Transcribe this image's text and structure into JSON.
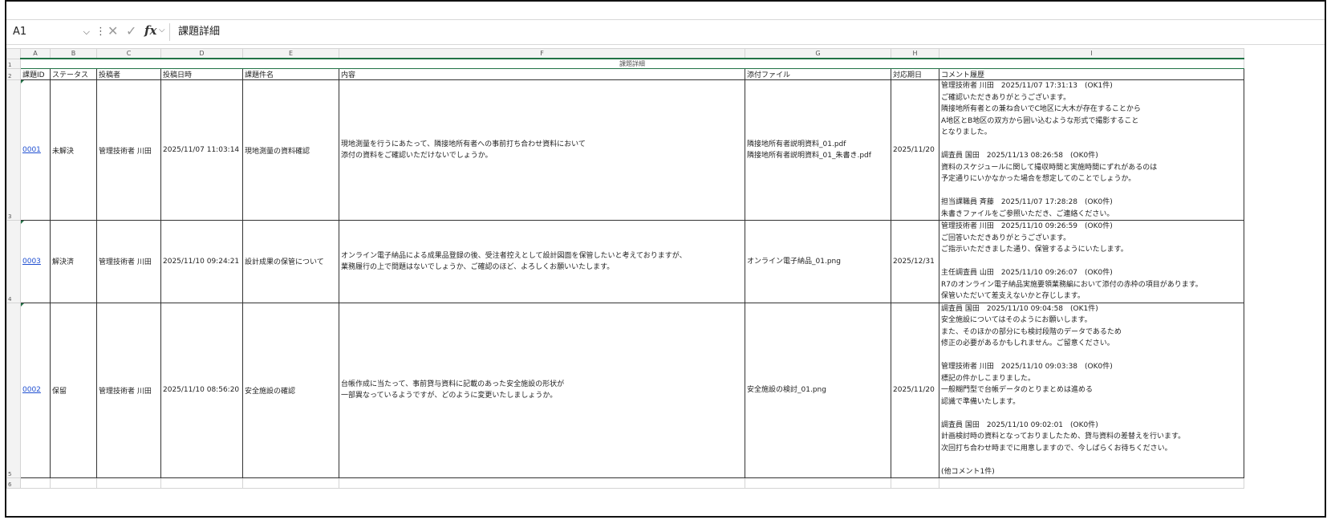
{
  "formula_bar": {
    "name_box": "A1",
    "content": "課題詳細"
  },
  "columns": [
    "A",
    "B",
    "C",
    "D",
    "E",
    "F",
    "G",
    "H",
    "I"
  ],
  "row_numbers": [
    "1",
    "2",
    "3",
    "4",
    "5",
    "6"
  ],
  "merged_title": "課題詳細",
  "headers": [
    "課題ID",
    "ステータス",
    "投稿者",
    "投稿日時",
    "課題件名",
    "内容",
    "添付ファイル",
    "対応期日",
    "コメント履歴"
  ],
  "rows": [
    {
      "id": "0001",
      "status": "未解決",
      "poster": "管理技術者 川田",
      "posted_at": "2025/11/07 11:03:14",
      "subject": "現地測量の資料確認",
      "content": [
        "現地測量を行うにあたって、隣接地所有者への事前打ち合わせ資料において",
        "添付の資料をご確認いただけないでしょうか。"
      ],
      "attachments": [
        "隣接地所有者説明資料_01.pdf",
        "隣接地所有者説明資料_01_朱書き.pdf"
      ],
      "due": "2025/11/20",
      "comments": [
        "管理技術者 川田　2025/11/07 17:31:13　(OK1件)",
        "ご確認いただきありがとうございます。",
        "隣接地所有者との兼ね合いでC地区に大木が存在することから",
        "A地区とB地区の双方から囲い込むような形式で撮影すること",
        "となりました。",
        "",
        "調査員 国田　2025/11/13 08:26:58　(OK0件)",
        "資料のスケジュールに関して撮収時間と実施時間にずれがあるのは",
        "予定通りにいかなかった場合を想定してのことでしょうか。",
        "",
        "担当課職員 斉藤　2025/11/07 17:28:28　(OK0件)",
        "朱書きファイルをご参照いただき、ご連絡ください。"
      ]
    },
    {
      "id": "0003",
      "status": "解決済",
      "poster": "管理技術者 川田",
      "posted_at": "2025/11/10 09:24:21",
      "subject": "設計成果の保管について",
      "content": [
        "オンライン電子納品による成果品登録の後、受注者控えとして設計図面を保管したいと考えておりますが、",
        "業務履行の上で問題はないでしょうか、ご確認のほど、よろしくお願いいたします。"
      ],
      "attachments": [
        "オンライン電子納品_01.png"
      ],
      "due": "2025/12/31",
      "comments": [
        "管理技術者 川田　2025/11/10 09:26:59　(OK0件)",
        "ご回答いただきありがとうございます。",
        "ご指示いただきました通り、保管するようにいたします。",
        "",
        "主任調査員 山田　2025/11/10 09:26:07　(OK0件)",
        "R7のオンライン電子納品実施要領業務編において添付の赤枠の項目があります。",
        "保管いただいて差支えないかと存じします。"
      ]
    },
    {
      "id": "0002",
      "status": "保留",
      "poster": "管理技術者 川田",
      "posted_at": "2025/11/10 08:56:20",
      "subject": "安全施設の確認",
      "content": [
        "台帳作成に当たって、事前貸与資料に記載のあった安全施設の形状が",
        "一部異なっているようですが、どのように変更いたしましょうか。"
      ],
      "attachments": [
        "安全施設の検討_01.png"
      ],
      "due": "2025/11/20",
      "comments": [
        "調査員 国田　2025/11/10 09:04:58　(OK1件)",
        "安全施設についてはそのようにお願いします。",
        "また、そのほかの部分にも検討段階のデータであるため",
        "修正の必要があるかもしれません。ご留意ください。",
        "",
        "管理技術者 川田　2025/11/10 09:03:38　(OK0件)",
        "標記の件かしこまりました。",
        "一般糊門型で台帳データのとりまとめは進める",
        "認識で準備いたします。",
        "",
        "調査員 国田　2025/11/10 09:02:01　(OK0件)",
        "計画検討時の資料となっておりましたため、貸与資料の差替えを行います。",
        "次回打ち合わせ時までに用意しますので、今しばらくお待ちください。",
        "",
        "(他コメント1件)"
      ]
    }
  ],
  "icons": {
    "name_box_dropdown": "chevron-down-icon",
    "more": "vertical-dots-icon",
    "cancel": "x-icon",
    "enter": "check-icon",
    "function": "fx-icon"
  }
}
